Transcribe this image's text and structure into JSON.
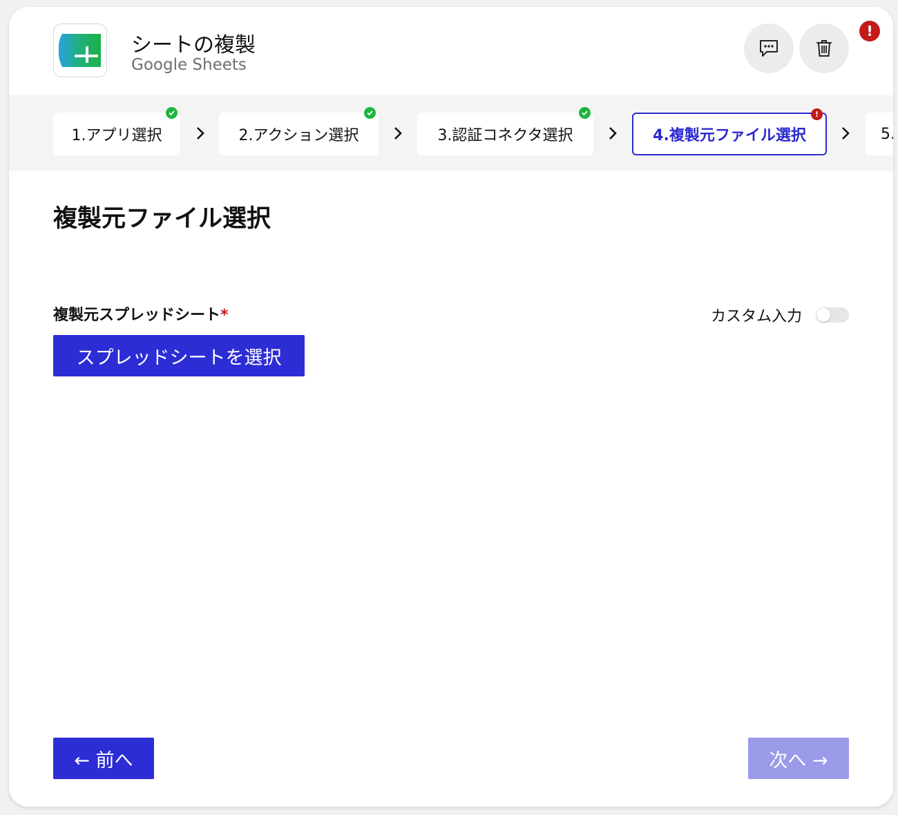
{
  "header": {
    "title": "シートの複製",
    "subtitle": "Google Sheets",
    "app_icon": "google-sheets-icon",
    "comment_icon": "comment-icon",
    "trash_icon": "trash-icon",
    "alert_mark": "!"
  },
  "steps": [
    {
      "label": "1.アプリ選択",
      "status": "complete"
    },
    {
      "label": "2.アクション選択",
      "status": "complete"
    },
    {
      "label": "3.認証コネクタ選択",
      "status": "complete"
    },
    {
      "label": "4.複製元ファイル選択",
      "status": "error"
    },
    {
      "label": "5.",
      "status": "pending"
    }
  ],
  "step_error_mark": "!",
  "section": {
    "title": "複製元ファイル選択"
  },
  "field": {
    "label": "複製元スプレッドシート",
    "required_mark": "*",
    "custom_input_label": "カスタム入力",
    "custom_input_enabled": false,
    "select_button": "スプレッドシートを選択"
  },
  "footer": {
    "prev_label": "← 前へ",
    "next_label": "次へ →"
  },
  "colors": {
    "primary": "#2d2dd6",
    "primary_disabled": "#9a9ae9",
    "success": "#1fb43d",
    "error": "#c41a1a"
  }
}
